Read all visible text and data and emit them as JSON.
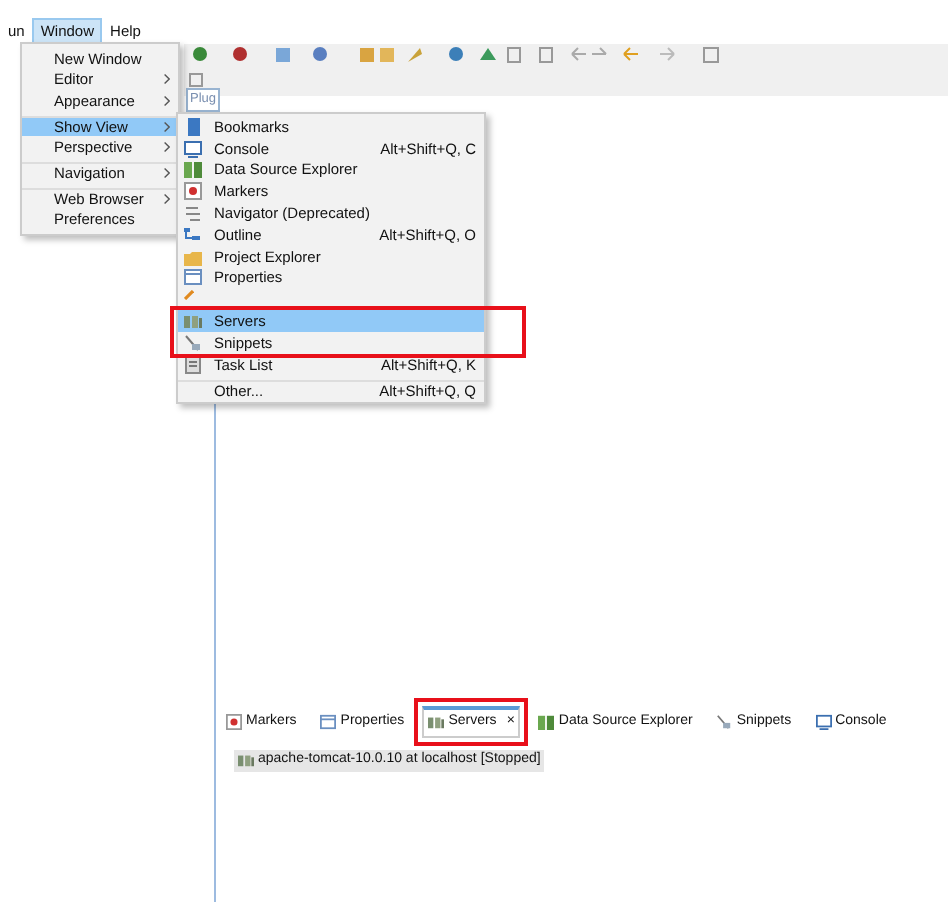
{
  "menubar": [
    {
      "label": "un",
      "selected": false
    },
    {
      "label": "Window",
      "selected": true
    },
    {
      "label": "Help",
      "selected": false
    }
  ],
  "editor_tab_fragment": "Plug",
  "window_menu": [
    {
      "label": "New Window",
      "submenu": false,
      "selected": false,
      "separator_before": false
    },
    {
      "label": "Editor",
      "submenu": true,
      "selected": false,
      "separator_before": false
    },
    {
      "label": "Appearance",
      "submenu": true,
      "selected": false,
      "separator_before": false
    },
    {
      "label": "Show View",
      "submenu": true,
      "selected": true,
      "separator_before": true
    },
    {
      "label": "Perspective",
      "submenu": true,
      "selected": false,
      "separator_before": false
    },
    {
      "label": "Navigation",
      "submenu": true,
      "selected": false,
      "separator_before": true
    },
    {
      "label": "Web Browser",
      "submenu": true,
      "selected": false,
      "separator_before": true
    },
    {
      "label": "Preferences",
      "submenu": false,
      "selected": false,
      "separator_before": false
    }
  ],
  "show_view_menu": [
    {
      "label": "Bookmarks",
      "kind": "bookmark",
      "selected": false
    },
    {
      "label": "Console",
      "shortcut": "Alt+Shift+Q, C",
      "kind": "console",
      "selected": false
    },
    {
      "label": "Data Source Explorer",
      "kind": "database",
      "selected": false
    },
    {
      "label": "Markers",
      "kind": "markers",
      "selected": false
    },
    {
      "label": "Navigator (Deprecated)",
      "kind": "navigator",
      "selected": false
    },
    {
      "label": "Outline",
      "shortcut": "Alt+Shift+Q, O",
      "kind": "outline",
      "selected": false
    },
    {
      "label": "Project Explorer",
      "kind": "folder",
      "selected": false
    },
    {
      "label": "Properties",
      "kind": "window",
      "selected": false
    },
    {
      "kind": "search",
      "selected": false
    },
    {
      "label": "Servers",
      "kind": "servers",
      "selected": true
    },
    {
      "label": "Snippets",
      "kind": "snippets",
      "selected": false
    },
    {
      "label": "Task List",
      "shortcut": "Alt+Shift+Q, K",
      "kind": "tasks",
      "selected": false
    },
    {
      "label": "Other...",
      "shortcut": "Alt+Shift+Q, Q",
      "selected": false,
      "separator_before": true
    }
  ],
  "bottom_tabs": [
    {
      "label": "Markers",
      "kind": "markers",
      "selected": false
    },
    {
      "label": "Properties",
      "kind": "window",
      "selected": false
    },
    {
      "label": "Servers",
      "kind": "servers",
      "selected": true,
      "closable": true
    },
    {
      "label": "Data Source Explorer",
      "kind": "database",
      "selected": false
    },
    {
      "label": "Snippets",
      "kind": "snippets",
      "selected": false
    },
    {
      "label": "Console",
      "kind": "console",
      "selected": false
    }
  ],
  "servers": [
    {
      "name": "apache-tomcat-10.0.10 at localhost",
      "state": "[Stopped]"
    }
  ],
  "close_glyph": "×"
}
